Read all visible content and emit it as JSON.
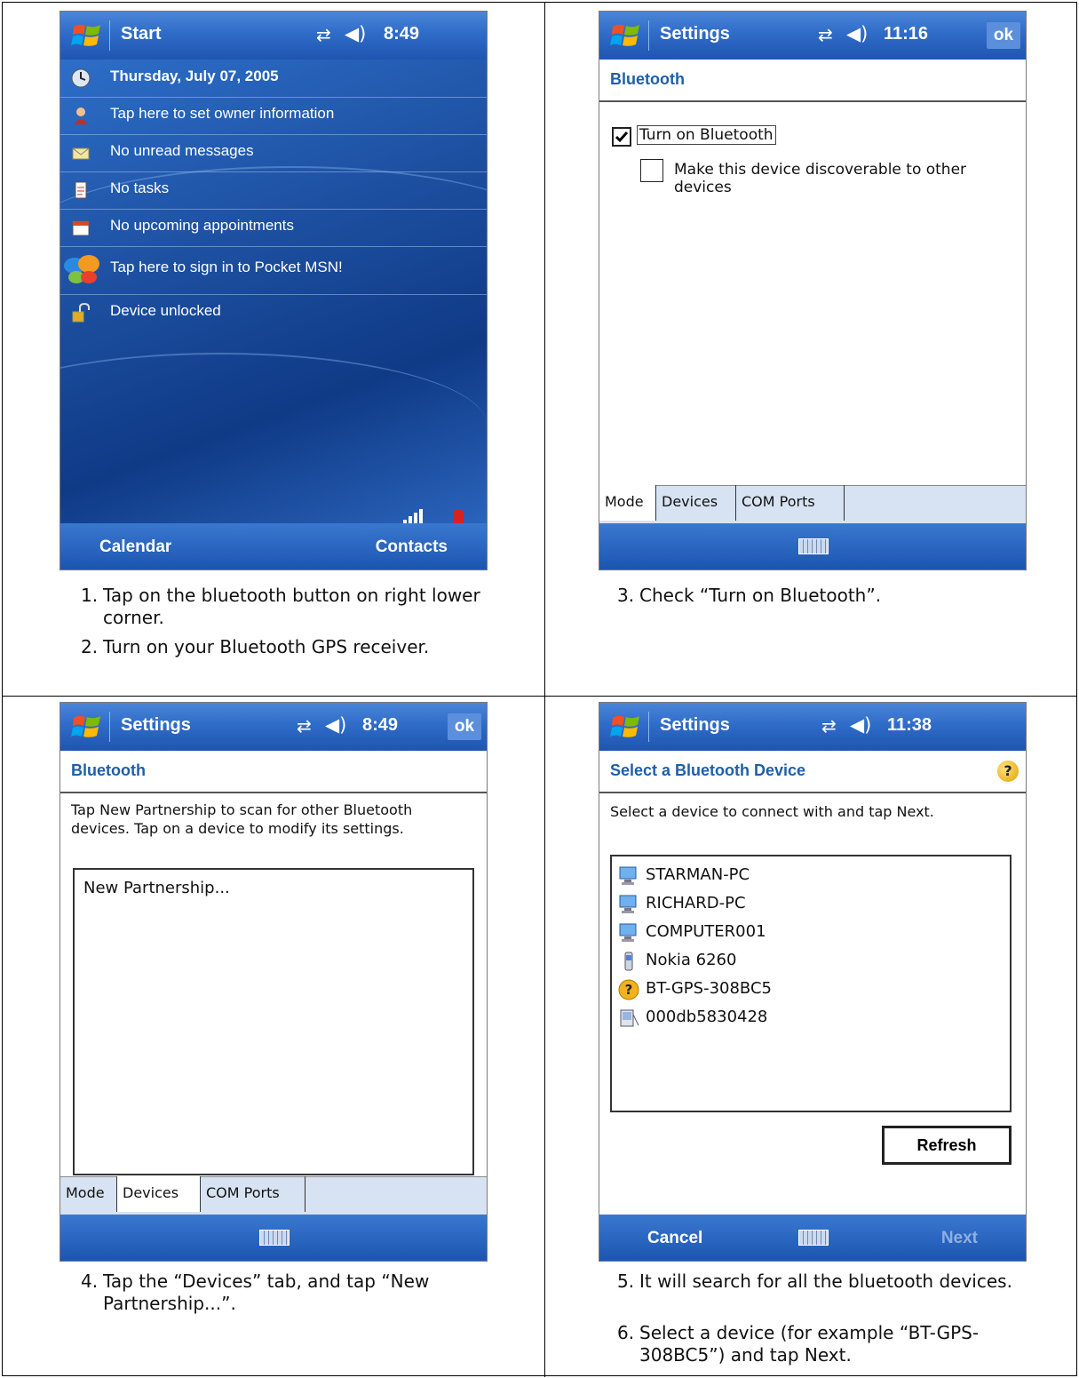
{
  "panels": {
    "p1": {
      "title": "Start",
      "time": "8:49",
      "rows": [
        "Thursday, July 07, 2005",
        "Tap here to set owner information",
        "No unread messages",
        "No tasks",
        "No upcoming appointments",
        "Tap here to sign in to Pocket MSN!",
        "Device unlocked"
      ],
      "softkey_left": "Calendar",
      "softkey_right": "Contacts",
      "captions": [
        {
          "num": "1.",
          "text": "Tap on the bluetooth button on right lower corner."
        },
        {
          "num": "2.",
          "text": "Turn on your Bluetooth GPS receiver."
        }
      ]
    },
    "p2": {
      "title": "Settings",
      "time": "11:16",
      "ok": "ok",
      "header": "Bluetooth",
      "check1": "Turn on Bluetooth",
      "check2": "Make this device discoverable to other devices",
      "tabs": [
        "Mode",
        "Devices",
        "COM Ports"
      ],
      "captions": [
        {
          "num": "3.",
          "text": "Check “Turn on Bluetooth”."
        }
      ]
    },
    "p3": {
      "title": "Settings",
      "time": "8:49",
      "ok": "ok",
      "header": "Bluetooth",
      "instructions": "Tap New Partnership to scan for other Bluetooth devices. Tap on a device to modify its settings.",
      "list_item": "New Partnership...",
      "tabs": [
        "Mode",
        "Devices",
        "COM Ports"
      ],
      "captions": [
        {
          "num": "4.",
          "text": "Tap the “Devices” tab, and tap “New Partnership...”."
        }
      ]
    },
    "p4": {
      "title": "Settings",
      "time": "11:38",
      "header": "Select a Bluetooth Device",
      "instructions": "Select a device to connect with and tap Next.",
      "devices": [
        {
          "name": "STARMAN-PC",
          "icon": "computer-icon"
        },
        {
          "name": "RICHARD-PC",
          "icon": "computer-icon"
        },
        {
          "name": "COMPUTER001",
          "icon": "computer-icon"
        },
        {
          "name": "Nokia 6260",
          "icon": "phone-icon"
        },
        {
          "name": "BT-GPS-308BC5",
          "icon": "unknown-device-icon"
        },
        {
          "name": "000db5830428",
          "icon": "pda-icon"
        }
      ],
      "refresh": "Refresh",
      "softkey_left": "Cancel",
      "softkey_right": "Next",
      "captions": [
        {
          "num": "5.",
          "text": "It will search for all the bluetooth devices."
        },
        {
          "num": "6.",
          "text": "Select a device (for example “BT-GPS-308BC5”) and tap Next."
        }
      ]
    }
  },
  "colors": {
    "titlebar": "#2f6cc8",
    "header_text": "#1f5fa8",
    "tab_bg": "#d7e3f3"
  }
}
